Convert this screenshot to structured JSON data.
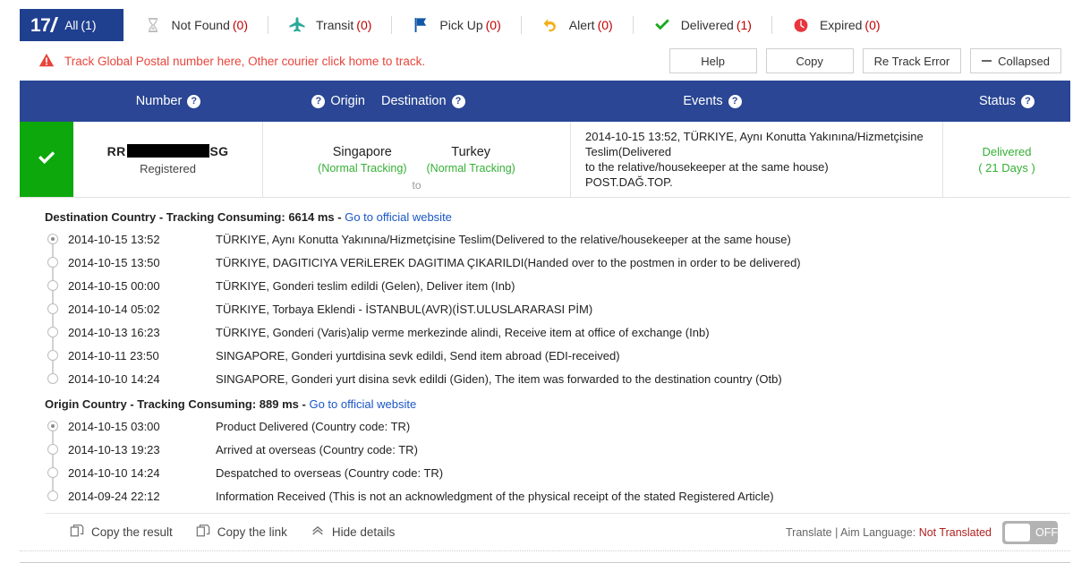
{
  "tabs": [
    {
      "id": "all",
      "logo": "17",
      "label": "All",
      "count": "(1)",
      "icon": "logo-17-icon",
      "active": true
    },
    {
      "id": "not-found",
      "label": "Not Found",
      "count": "(0)",
      "icon": "hourglass-icon",
      "active": false
    },
    {
      "id": "transit",
      "label": "Transit",
      "count": "(0)",
      "icon": "airplane-icon",
      "active": false
    },
    {
      "id": "pick-up",
      "label": "Pick Up",
      "count": "(0)",
      "icon": "flag-icon",
      "active": false
    },
    {
      "id": "alert",
      "label": "Alert",
      "count": "(0)",
      "icon": "undo-arrow-icon",
      "active": false
    },
    {
      "id": "delivered",
      "label": "Delivered",
      "count": "(1)",
      "icon": "check-icon",
      "active": false
    },
    {
      "id": "expired",
      "label": "Expired",
      "count": "(0)",
      "icon": "clock-icon",
      "active": false
    }
  ],
  "notice": {
    "icon": "warning-triangle-icon",
    "text": "Track Global Postal number here, Other courier click home to track.",
    "color": "#e8453c"
  },
  "toolbar": {
    "help_label": "Help",
    "copy_label": "Copy",
    "retrack_label": "Re Track Error",
    "collapsed_label": "Collapsed"
  },
  "table_header": {
    "number": "Number",
    "origin": "Origin",
    "destination": "Destination",
    "events": "Events",
    "status": "Status",
    "help_glyph": "?"
  },
  "row": {
    "status_icon": "check-icon",
    "status_color": "#0ca80c",
    "tracking_prefix": "RR",
    "tracking_suffix": "SG",
    "tracking_redacted": true,
    "tracking_sub": "Registered",
    "origin": {
      "name": "Singapore",
      "type": "(Normal Tracking)"
    },
    "to_word": "to",
    "destination": {
      "name": "Turkey",
      "type": "(Normal Tracking)"
    },
    "event_lines": [
      "2014-10-15 13:52, TÜRKIYE, Aynı Konutta Yakınına/Hizmetçisine Teslim(Delivered",
      "to the relative/housekeeper at the same house)",
      "POST.DAĞ.TOP."
    ],
    "status_text": "Delivered",
    "status_days": "( 21 Days )",
    "status_text_color": "#35b035"
  },
  "destination_section": {
    "title_bold": "Destination Country",
    "title_consuming": "- Tracking Consuming: 6614 ms -",
    "link": "Go to official website",
    "events": [
      {
        "time": "2014-10-15 13:52",
        "text": "TÜRKIYE, Aynı Konutta Yakınına/Hizmetçisine Teslim(Delivered to the relative/housekeeper at the same house)",
        "current": true
      },
      {
        "time": "2014-10-15 13:50",
        "text": "TÜRKIYE, DAGITICIYA VERiLEREK DAGITIMA ÇIKARILDI(Handed over to the postmen in order to be delivered)",
        "current": false
      },
      {
        "time": "2014-10-15 00:00",
        "text": "TÜRKIYE, Gonderi teslim edildi (Gelen), Deliver item (Inb)",
        "current": false
      },
      {
        "time": "2014-10-14 05:02",
        "text": "TÜRKIYE, Torbaya Eklendi - İSTANBUL(AVR)(İST.ULUSLARARASI PİM)",
        "current": false
      },
      {
        "time": "2014-10-13 16:23",
        "text": "TÜRKIYE, Gonderi (Varis)alip verme merkezinde alindi, Receive item at office of exchange (Inb)",
        "current": false
      },
      {
        "time": "2014-10-11 23:50",
        "text": "SINGAPORE, Gonderi yurtdisina sevk edildi, Send item abroad (EDI-received)",
        "current": false
      },
      {
        "time": "2014-10-10 14:24",
        "text": "SINGAPORE, Gonderi yurt disina sevk edildi (Giden), The item was forwarded to the destination country (Otb)",
        "current": false
      }
    ]
  },
  "origin_section": {
    "title_bold": "Origin Country",
    "title_consuming": "- Tracking Consuming: 889 ms -",
    "link": "Go to official website",
    "events": [
      {
        "time": "2014-10-15 03:00",
        "text": "Product Delivered (Country code: TR)",
        "current": true
      },
      {
        "time": "2014-10-13 19:23",
        "text": "Arrived at overseas (Country code: TR)",
        "current": false
      },
      {
        "time": "2014-10-10 14:24",
        "text": "Despatched to overseas (Country code: TR)",
        "current": false
      },
      {
        "time": "2014-09-24 22:12",
        "text": "Information Received (This is not an acknowledgment of the physical receipt of the stated Registered Article)",
        "current": false
      }
    ]
  },
  "detail_footer": {
    "copy_result": "Copy the result",
    "copy_link": "Copy the link",
    "hide_details": "Hide details",
    "translate_prefix": "Translate | Aim Language:",
    "translate_value": "Not Translated",
    "toggle_label": "OFF",
    "toggle_state": "off"
  },
  "colors": {
    "header_blue": "#2a4694",
    "logo_blue": "#1f3f8f",
    "green": "#0ca80c",
    "green_text": "#35b035",
    "red": "#c00000",
    "link_blue": "#1a56c4"
  }
}
